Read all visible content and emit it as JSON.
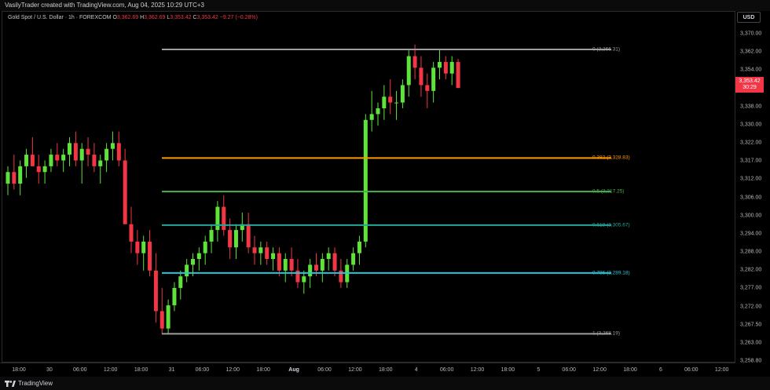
{
  "header": {
    "creator": "VasilyTrader created with TradingView.com, Aug 04, 2025 10:29 UTC+3",
    "symbol": "Gold Spot / U.S. Dollar · 1h · FOREXCOM",
    "open_label": "O",
    "open": "3,362.69",
    "high_label": "H",
    "high": "3,362.69",
    "low_label": "L",
    "low": "3,353.42",
    "close_label": "C",
    "close": "3,353.42",
    "change": "−9.27 (−0.28%)"
  },
  "currency": "USD",
  "price_tag": {
    "price": "3,353.42",
    "countdown": "30:29",
    "color": "#f23645"
  },
  "price_ticks": [
    "3,370.00",
    "3,362.00",
    "3,354.00",
    "3,346.00",
    "3,338.00",
    "3,330.00",
    "3,322.00",
    "3,317.00",
    "3,312.00",
    "3,306.00",
    "3,300.00",
    "3,294.00",
    "3,288.00",
    "3,282.00",
    "3,277.00",
    "3,272.00",
    "3,267.50",
    "3,263.00",
    "3,258.80"
  ],
  "time_labels": [
    {
      "t": "18:00",
      "bold": false
    },
    {
      "t": "30",
      "bold": false
    },
    {
      "t": "06:00",
      "bold": false
    },
    {
      "t": "12:00",
      "bold": false
    },
    {
      "t": "18:00",
      "bold": false
    },
    {
      "t": "31",
      "bold": false
    },
    {
      "t": "06:00",
      "bold": false
    },
    {
      "t": "12:00",
      "bold": false
    },
    {
      "t": "18:00",
      "bold": false
    },
    {
      "t": "Aug",
      "bold": true
    },
    {
      "t": "06:00",
      "bold": false
    },
    {
      "t": "12:00",
      "bold": false
    },
    {
      "t": "18:00",
      "bold": false
    },
    {
      "t": "4",
      "bold": false
    },
    {
      "t": "06:00",
      "bold": false
    },
    {
      "t": "12:00",
      "bold": false
    },
    {
      "t": "18:00",
      "bold": false
    },
    {
      "t": "5",
      "bold": false
    },
    {
      "t": "06:00",
      "bold": false
    },
    {
      "t": "12:00",
      "bold": false
    },
    {
      "t": "18:00",
      "bold": false
    },
    {
      "t": "6",
      "bold": false
    },
    {
      "t": "06:00",
      "bold": false
    },
    {
      "t": "12:00",
      "bold": false
    }
  ],
  "fib_levels": [
    {
      "label": "0 (3,366.31)",
      "price": 3366.31,
      "color": "#9e9e9e"
    },
    {
      "label": "0.382 (3,328.83)",
      "price": 3328.83,
      "color": "#ff9800"
    },
    {
      "label": "0.5 (3,317.25)",
      "price": 3317.25,
      "color": "#4caf50"
    },
    {
      "label": "0.618 (3,305.67)",
      "price": 3305.67,
      "color": "#26a69a"
    },
    {
      "label": "0.786 (3,289.18)",
      "price": 3289.18,
      "color": "#26c6da"
    },
    {
      "label": "1 (3,268.19)",
      "price": 3268.19,
      "color": "#9e9e9e"
    }
  ],
  "colors": {
    "up": "#5fe33a",
    "down": "#f23645",
    "background": "#000000"
  },
  "footer": {
    "brand": "TradingView",
    "logo_icon": "tradingview-logo-icon"
  },
  "chart_data": {
    "type": "candlestick",
    "y_range": [
      3258.8,
      3372
    ],
    "candles": [
      [
        3320,
        3326,
        3316,
        3324
      ],
      [
        3324,
        3330,
        3318,
        3320
      ],
      [
        3320,
        3328,
        3316,
        3326
      ],
      [
        3326,
        3332,
        3322,
        3330
      ],
      [
        3330,
        3336,
        3326,
        3326
      ],
      [
        3326,
        3330,
        3320,
        3324
      ],
      [
        3324,
        3328,
        3320,
        3326
      ],
      [
        3326,
        3332,
        3324,
        3330
      ],
      [
        3330,
        3334,
        3326,
        3328
      ],
      [
        3328,
        3332,
        3324,
        3330
      ],
      [
        3330,
        3336,
        3326,
        3334
      ],
      [
        3334,
        3338,
        3326,
        3328
      ],
      [
        3328,
        3334,
        3320,
        3332
      ],
      [
        3332,
        3336,
        3326,
        3330
      ],
      [
        3330,
        3334,
        3324,
        3326
      ],
      [
        3326,
        3330,
        3320,
        3328
      ],
      [
        3328,
        3334,
        3324,
        3332
      ],
      [
        3332,
        3338,
        3328,
        3334
      ],
      [
        3334,
        3338,
        3326,
        3328
      ],
      [
        3328,
        3332,
        3318,
        3306
      ],
      [
        3306,
        3312,
        3296,
        3300
      ],
      [
        3300,
        3304,
        3292,
        3296
      ],
      [
        3296,
        3302,
        3290,
        3300
      ],
      [
        3300,
        3304,
        3288,
        3290
      ],
      [
        3290,
        3296,
        3272,
        3276
      ],
      [
        3276,
        3284,
        3268,
        3270
      ],
      [
        3270,
        3280,
        3268,
        3278
      ],
      [
        3278,
        3286,
        3276,
        3284
      ],
      [
        3284,
        3290,
        3280,
        3288
      ],
      [
        3288,
        3294,
        3286,
        3292
      ],
      [
        3292,
        3296,
        3288,
        3294
      ],
      [
        3294,
        3298,
        3290,
        3296
      ],
      [
        3296,
        3302,
        3292,
        3300
      ],
      [
        3300,
        3306,
        3296,
        3304
      ],
      [
        3304,
        3314,
        3300,
        3312
      ],
      [
        3312,
        3316,
        3302,
        3304
      ],
      [
        3304,
        3308,
        3294,
        3298
      ],
      [
        3298,
        3306,
        3294,
        3304
      ],
      [
        3304,
        3310,
        3300,
        3306
      ],
      [
        3306,
        3310,
        3296,
        3298
      ],
      [
        3298,
        3302,
        3292,
        3296
      ],
      [
        3296,
        3300,
        3292,
        3298
      ],
      [
        3298,
        3300,
        3292,
        3294
      ],
      [
        3294,
        3298,
        3290,
        3296
      ],
      [
        3296,
        3298,
        3288,
        3290
      ],
      [
        3290,
        3296,
        3286,
        3294
      ],
      [
        3294,
        3298,
        3288,
        3290
      ],
      [
        3290,
        3294,
        3284,
        3286
      ],
      [
        3286,
        3290,
        3282,
        3288
      ],
      [
        3288,
        3294,
        3284,
        3292
      ],
      [
        3292,
        3296,
        3288,
        3290
      ],
      [
        3290,
        3296,
        3286,
        3294
      ],
      [
        3294,
        3298,
        3290,
        3296
      ],
      [
        3296,
        3298,
        3288,
        3290
      ],
      [
        3290,
        3294,
        3284,
        3286
      ],
      [
        3286,
        3294,
        3284,
        3292
      ],
      [
        3292,
        3298,
        3290,
        3296
      ],
      [
        3296,
        3302,
        3292,
        3300
      ],
      [
        3300,
        3344,
        3298,
        3342
      ],
      [
        3342,
        3352,
        3338,
        3344
      ],
      [
        3344,
        3348,
        3340,
        3346
      ],
      [
        3346,
        3354,
        3342,
        3350
      ],
      [
        3350,
        3356,
        3344,
        3348
      ],
      [
        3348,
        3352,
        3342,
        3348
      ],
      [
        3348,
        3356,
        3346,
        3354
      ],
      [
        3354,
        3366,
        3350,
        3364
      ],
      [
        3364,
        3368,
        3356,
        3360
      ],
      [
        3360,
        3364,
        3350,
        3354
      ],
      [
        3354,
        3358,
        3346,
        3352
      ],
      [
        3352,
        3362,
        3348,
        3360
      ],
      [
        3360,
        3366,
        3356,
        3362
      ],
      [
        3362,
        3364,
        3356,
        3358
      ],
      [
        3358,
        3364,
        3354,
        3362
      ],
      [
        3362,
        3363,
        3353,
        3353
      ]
    ]
  }
}
